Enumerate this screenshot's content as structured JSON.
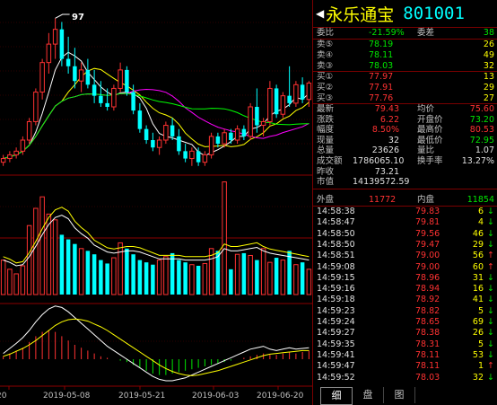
{
  "stock": {
    "name": "永乐通宝",
    "code": "801001"
  },
  "orderbook": {
    "ratio": {
      "label": "委比",
      "value": "-21.59%",
      "diff_label": "委差",
      "diff": "38"
    },
    "sells": [
      {
        "label": "卖⑤",
        "price": "78.19",
        "vol": "26"
      },
      {
        "label": "卖④",
        "price": "78.11",
        "vol": "49"
      },
      {
        "label": "卖③",
        "price": "78.03",
        "vol": "32"
      }
    ],
    "buys": [
      {
        "label": "买①",
        "price": "77.97",
        "vol": "13"
      },
      {
        "label": "买②",
        "price": "77.91",
        "vol": "29"
      },
      {
        "label": "买③",
        "price": "77.76",
        "vol": "27"
      }
    ]
  },
  "stats": [
    {
      "l1": "最新",
      "v1": "79.43",
      "l2": "均价",
      "v2": "75.60",
      "c1": "red",
      "c2": "red"
    },
    {
      "l1": "涨跌",
      "v1": "6.22",
      "l2": "开盘价",
      "v2": "73.20",
      "c1": "red",
      "c2": "grn"
    },
    {
      "l1": "幅度",
      "v1": "8.50%",
      "l2": "最高价",
      "v2": "80.53",
      "c1": "red",
      "c2": "red"
    },
    {
      "l1": "现量",
      "v1": "32",
      "l2": "最低价",
      "v2": "72.95",
      "c1": "wht",
      "c2": "grn"
    },
    {
      "l1": "总量",
      "v1": "23626",
      "l2": "量比",
      "v2": "1.07",
      "c1": "wht",
      "c2": "wht"
    },
    {
      "l1": "成交额",
      "v1": "1786065.10",
      "l2": "换手率",
      "v2": "13.27%",
      "c1": "wht",
      "c2": "wht"
    },
    {
      "l1": "昨收",
      "v1": "73.21",
      "l2": "",
      "v2": "",
      "c1": "wht",
      "c2": "wht"
    },
    {
      "l1": "市值",
      "v1": "14139572.59",
      "l2": "",
      "v2": "",
      "c1": "wht",
      "c2": "wht"
    }
  ],
  "volume_split": {
    "outer_label": "外盘",
    "outer": "11772",
    "inner_label": "内盘",
    "inner": "11854"
  },
  "ticks": [
    {
      "time": "14:58:38",
      "price": "79.83",
      "vol": "6",
      "dir": "↓"
    },
    {
      "time": "14:58:47",
      "price": "79.81",
      "vol": "4",
      "dir": "↓"
    },
    {
      "time": "14:58:50",
      "price": "79.56",
      "vol": "46",
      "dir": "↓"
    },
    {
      "time": "14:58:50",
      "price": "79.47",
      "vol": "29",
      "dir": "↓"
    },
    {
      "time": "14:58:51",
      "price": "79.00",
      "vol": "56",
      "dir": "↑"
    },
    {
      "time": "14:59:08",
      "price": "79.00",
      "vol": "60",
      "dir": "↑"
    },
    {
      "time": "14:59:15",
      "price": "78.96",
      "vol": "31",
      "dir": "↓"
    },
    {
      "time": "14:59:16",
      "price": "78.94",
      "vol": "16",
      "dir": "↓"
    },
    {
      "time": "14:59:18",
      "price": "78.92",
      "vol": "41",
      "dir": "↓"
    },
    {
      "time": "14:59:23",
      "price": "78.82",
      "vol": "5",
      "dir": "↓"
    },
    {
      "time": "14:59:24",
      "price": "78.65",
      "vol": "69",
      "dir": "↓"
    },
    {
      "time": "14:59:27",
      "price": "78.38",
      "vol": "26",
      "dir": "↓"
    },
    {
      "time": "14:59:35",
      "price": "78.31",
      "vol": "5",
      "dir": "↓"
    },
    {
      "time": "14:59:41",
      "price": "78.11",
      "vol": "53",
      "dir": "↓"
    },
    {
      "time": "14:59:47",
      "price": "78.11",
      "vol": "1",
      "dir": "↑"
    },
    {
      "time": "14:59:52",
      "price": "78.03",
      "vol": "32",
      "dir": "↓"
    }
  ],
  "tabs": [
    "细",
    "盘",
    "图"
  ],
  "chart_data": {
    "type": "candlestick",
    "peak_label": "97",
    "x_tick_labels": [
      "20",
      "2019-05-08",
      "2019-05-21",
      "2019-06-03",
      "2019-06-20"
    ],
    "candles": [
      {
        "o": 58,
        "h": 60,
        "l": 57,
        "c": 59
      },
      {
        "o": 59,
        "h": 61,
        "l": 58,
        "c": 60
      },
      {
        "o": 60,
        "h": 62,
        "l": 59,
        "c": 61
      },
      {
        "o": 61,
        "h": 65,
        "l": 60,
        "c": 64
      },
      {
        "o": 64,
        "h": 70,
        "l": 63,
        "c": 69
      },
      {
        "o": 69,
        "h": 78,
        "l": 68,
        "c": 77
      },
      {
        "o": 77,
        "h": 86,
        "l": 75,
        "c": 85
      },
      {
        "o": 85,
        "h": 93,
        "l": 82,
        "c": 90
      },
      {
        "o": 90,
        "h": 97,
        "l": 86,
        "c": 94
      },
      {
        "o": 94,
        "h": 96,
        "l": 84,
        "c": 86
      },
      {
        "o": 86,
        "h": 92,
        "l": 82,
        "c": 84
      },
      {
        "o": 84,
        "h": 89,
        "l": 78,
        "c": 80
      },
      {
        "o": 80,
        "h": 85,
        "l": 77,
        "c": 83
      },
      {
        "o": 83,
        "h": 86,
        "l": 78,
        "c": 79
      },
      {
        "o": 79,
        "h": 83,
        "l": 74,
        "c": 76
      },
      {
        "o": 76,
        "h": 80,
        "l": 73,
        "c": 74
      },
      {
        "o": 74,
        "h": 78,
        "l": 72,
        "c": 73
      },
      {
        "o": 73,
        "h": 79,
        "l": 72,
        "c": 78
      },
      {
        "o": 78,
        "h": 85,
        "l": 77,
        "c": 83
      },
      {
        "o": 83,
        "h": 84,
        "l": 76,
        "c": 77
      },
      {
        "o": 77,
        "h": 79,
        "l": 71,
        "c": 72
      },
      {
        "o": 72,
        "h": 74,
        "l": 66,
        "c": 67
      },
      {
        "o": 67,
        "h": 68,
        "l": 63,
        "c": 64
      },
      {
        "o": 64,
        "h": 66,
        "l": 61,
        "c": 62
      },
      {
        "o": 62,
        "h": 65,
        "l": 60,
        "c": 64
      },
      {
        "o": 64,
        "h": 69,
        "l": 63,
        "c": 68
      },
      {
        "o": 68,
        "h": 70,
        "l": 64,
        "c": 65
      },
      {
        "o": 65,
        "h": 67,
        "l": 60,
        "c": 61
      },
      {
        "o": 61,
        "h": 63,
        "l": 58,
        "c": 59
      },
      {
        "o": 59,
        "h": 62,
        "l": 57,
        "c": 61
      },
      {
        "o": 61,
        "h": 62,
        "l": 57,
        "c": 58
      },
      {
        "o": 58,
        "h": 61,
        "l": 57,
        "c": 60
      },
      {
        "o": 60,
        "h": 66,
        "l": 59,
        "c": 65
      },
      {
        "o": 65,
        "h": 66,
        "l": 62,
        "c": 63
      },
      {
        "o": 63,
        "h": 67,
        "l": 62,
        "c": 66
      },
      {
        "o": 66,
        "h": 67,
        "l": 63,
        "c": 64
      },
      {
        "o": 64,
        "h": 68,
        "l": 63,
        "c": 67
      },
      {
        "o": 67,
        "h": 68,
        "l": 64,
        "c": 65
      },
      {
        "o": 65,
        "h": 74,
        "l": 64,
        "c": 73
      },
      {
        "o": 73,
        "h": 78,
        "l": 66,
        "c": 68
      },
      {
        "o": 68,
        "h": 70,
        "l": 65,
        "c": 69
      },
      {
        "o": 69,
        "h": 80,
        "l": 68,
        "c": 78
      },
      {
        "o": 78,
        "h": 79,
        "l": 70,
        "c": 71
      },
      {
        "o": 71,
        "h": 77,
        "l": 70,
        "c": 76
      },
      {
        "o": 76,
        "h": 84,
        "l": 73,
        "c": 74
      },
      {
        "o": 74,
        "h": 80,
        "l": 73,
        "c": 79
      },
      {
        "o": 79,
        "h": 81,
        "l": 74,
        "c": 75
      },
      {
        "o": 75,
        "h": 80,
        "l": 73,
        "c": 79.43
      }
    ],
    "volumes": [
      30,
      22,
      18,
      25,
      60,
      75,
      85,
      70,
      65,
      52,
      48,
      44,
      40,
      38,
      35,
      30,
      27,
      32,
      45,
      40,
      35,
      30,
      28,
      26,
      30,
      33,
      36,
      30,
      28,
      26,
      25,
      27,
      40,
      38,
      98,
      22,
      35,
      36,
      34,
      30,
      40,
      28,
      32,
      30,
      38,
      26,
      28,
      22
    ],
    "volume_ma": [
      30,
      28,
      25,
      26,
      33,
      42,
      52,
      61,
      67,
      69,
      66,
      58,
      53,
      49,
      43,
      40,
      37,
      36,
      37,
      38,
      38,
      37,
      35,
      33,
      31,
      31,
      31,
      31,
      30,
      30,
      30,
      30,
      31,
      33,
      40,
      38,
      38,
      39,
      40,
      41,
      38,
      36,
      35,
      34,
      33,
      32,
      31,
      30
    ],
    "macd_hist": [
      2,
      4,
      6,
      8,
      12,
      16,
      19,
      20,
      19,
      16,
      13,
      10,
      8,
      6,
      4,
      2,
      1,
      0,
      -1,
      -2,
      -4,
      -6,
      -8,
      -10,
      -11,
      -11,
      -10,
      -9,
      -8,
      -7,
      -6,
      -5,
      -4,
      -3,
      -2,
      -1,
      0,
      1,
      2,
      3,
      4,
      3,
      3,
      4,
      5,
      4,
      5,
      6
    ],
    "macd_dif": [
      8,
      15,
      22,
      30,
      40,
      52,
      62,
      70,
      74,
      72,
      66,
      58,
      50,
      42,
      34,
      26,
      18,
      12,
      6,
      0,
      -6,
      -12,
      -18,
      -24,
      -28,
      -30,
      -30,
      -28,
      -26,
      -22,
      -18,
      -14,
      -10,
      -6,
      -2,
      2,
      6,
      10,
      14,
      16,
      18,
      14,
      12,
      14,
      16,
      14,
      15,
      16
    ],
    "macd_dea": [
      4,
      7,
      11,
      15,
      20,
      26,
      33,
      40,
      47,
      52,
      55,
      56,
      55,
      53,
      49,
      45,
      40,
      34,
      28,
      22,
      16,
      10,
      4,
      -2,
      -8,
      -13,
      -17,
      -20,
      -22,
      -23,
      -22,
      -20,
      -18,
      -16,
      -13,
      -10,
      -7,
      -4,
      -1,
      2,
      5,
      7,
      8,
      9,
      10,
      11,
      12,
      12
    ]
  }
}
